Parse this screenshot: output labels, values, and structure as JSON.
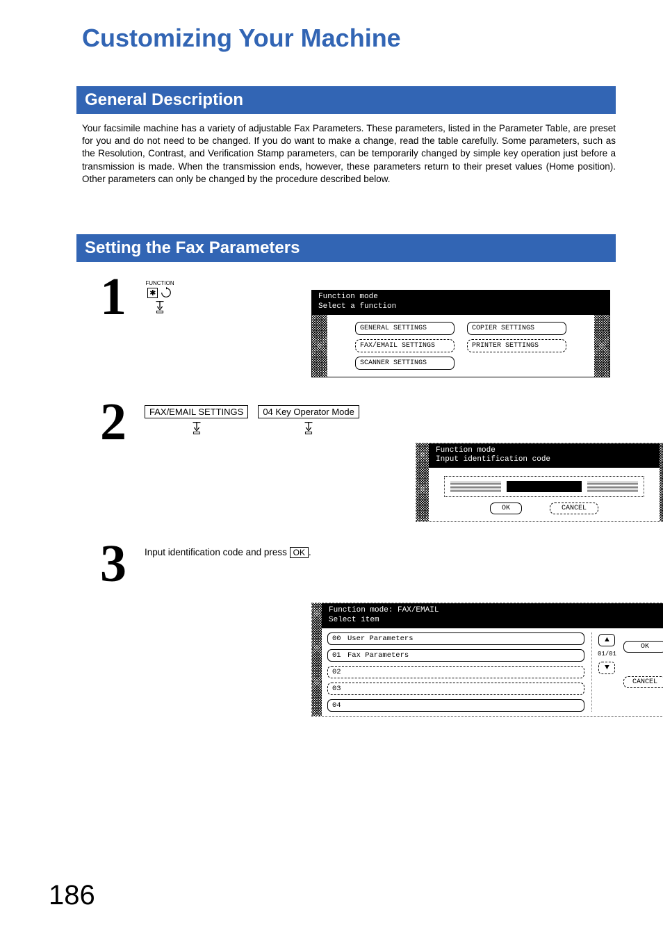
{
  "page_title": "Customizing Your Machine",
  "section1_title": "General Description",
  "section1_body": "Your facsimile machine has a variety of adjustable Fax Parameters. These parameters, listed in the Parameter Table, are preset for you and do not need to be changed.  If you do want to make a change, read the table carefully.  Some parameters, such as the Resolution, Contrast, and Verification Stamp parameters, can be temporarily changed by simple key operation just before a transmission is made.  When the transmission ends, however, these parameters return to their preset values (Home position).  Other parameters can only be changed by the procedure described below.",
  "section2_title": "Setting the Fax Parameters",
  "steps": {
    "step1": {
      "num": "1",
      "function_label": "FUNCTION"
    },
    "step2": {
      "num": "2",
      "btn_a": "FAX/EMAIL SETTINGS",
      "btn_b": "04 Key Operator Mode"
    },
    "step3": {
      "num": "3",
      "text_before": "Input identification code and press ",
      "ok": "OK",
      "text_after": "."
    }
  },
  "screen1": {
    "hdr1": "Function mode",
    "hdr2": "Select a function",
    "buttons": {
      "general": "GENERAL SETTINGS",
      "copier": "COPIER SETTINGS",
      "faxemail": "FAX/EMAIL SETTINGS",
      "printer": "PRINTER SETTINGS",
      "scanner": "SCANNER SETTINGS"
    }
  },
  "screen2": {
    "hdr1": "Function mode",
    "hdr2": "Input identification code",
    "ok": "OK",
    "cancel": "CANCEL"
  },
  "screen3": {
    "hdr1": "Function mode: FAX/EMAIL",
    "hdr2": "Select item",
    "items": [
      {
        "idx": "00",
        "label": "User Parameters",
        "style": "solid"
      },
      {
        "idx": "01",
        "label": "Fax Parameters",
        "style": "solid"
      },
      {
        "idx": "02",
        "label": "",
        "style": "dashed"
      },
      {
        "idx": "03",
        "label": "",
        "style": "dashed"
      },
      {
        "idx": "04",
        "label": "",
        "style": "solid"
      }
    ],
    "page_indicator": "01/01",
    "ok": "OK",
    "cancel": "CANCEL"
  },
  "page_number": "186"
}
